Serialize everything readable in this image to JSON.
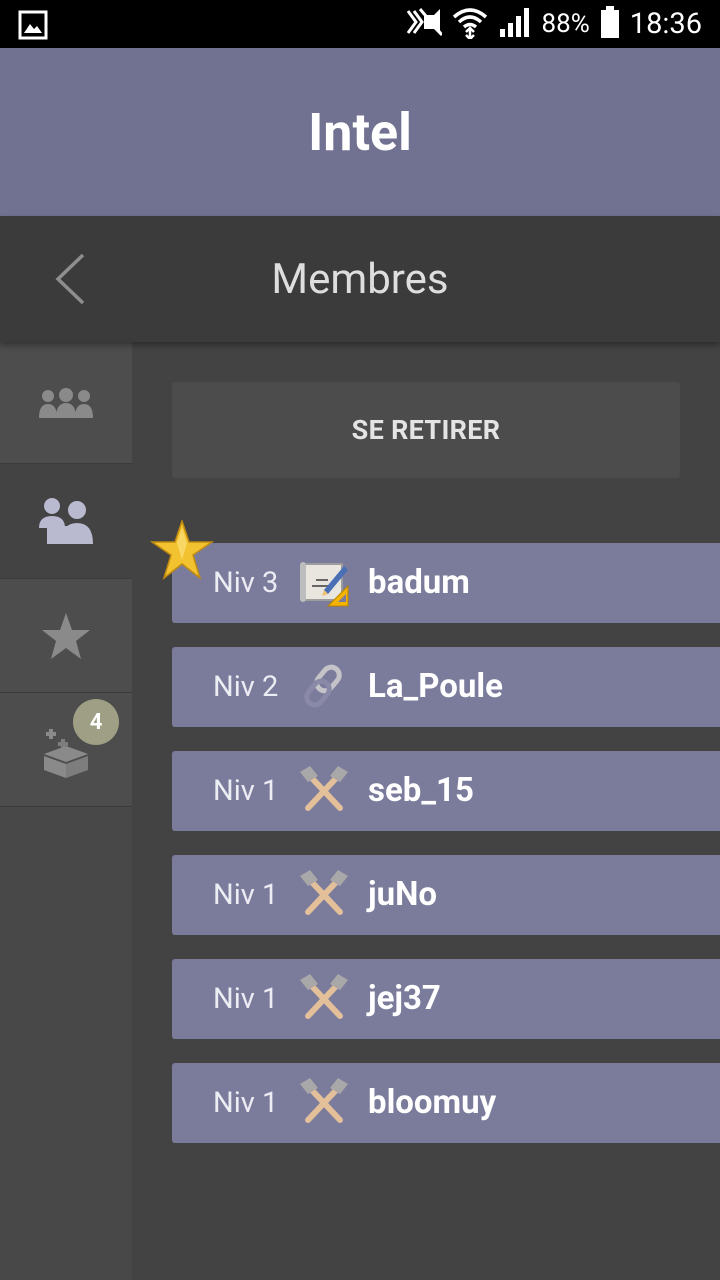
{
  "status_bar": {
    "left_icon": "gallery-notification-icon",
    "icons": [
      "nfc-icon",
      "mute-icon",
      "wifi-icon",
      "signal-icon",
      "battery-icon"
    ],
    "battery": "88%",
    "time": "18:36"
  },
  "header": {
    "title": "Intel"
  },
  "subheader": {
    "title": "Membres",
    "back_icon": "back-chevron-icon"
  },
  "sidebar": {
    "items": [
      {
        "icon": "group-icon",
        "active": false
      },
      {
        "icon": "members-icon",
        "active": true
      },
      {
        "icon": "star-icon",
        "active": false
      },
      {
        "icon": "add-crate-icon",
        "active": false,
        "badge": "4"
      }
    ]
  },
  "main": {
    "withdraw_label": "SE RETIRER",
    "members": [
      {
        "level": "Niv 3",
        "role_icon": "blueprint-icon",
        "name": "badum",
        "leader": true
      },
      {
        "level": "Niv 2",
        "role_icon": "link-icon",
        "name": "La_Poule"
      },
      {
        "level": "Niv 1",
        "role_icon": "crossed-axes-icon",
        "name": "seb_15"
      },
      {
        "level": "Niv 1",
        "role_icon": "crossed-axes-icon",
        "name": "juNo"
      },
      {
        "level": "Niv 1",
        "role_icon": "crossed-axes-icon",
        "name": "jej37"
      },
      {
        "level": "Niv 1",
        "role_icon": "crossed-axes-icon",
        "name": "bloomuy"
      }
    ]
  },
  "colors": {
    "header_bg": "#717191",
    "row_bg": "#7b7c9c",
    "badge_bg": "#9f9f85"
  }
}
